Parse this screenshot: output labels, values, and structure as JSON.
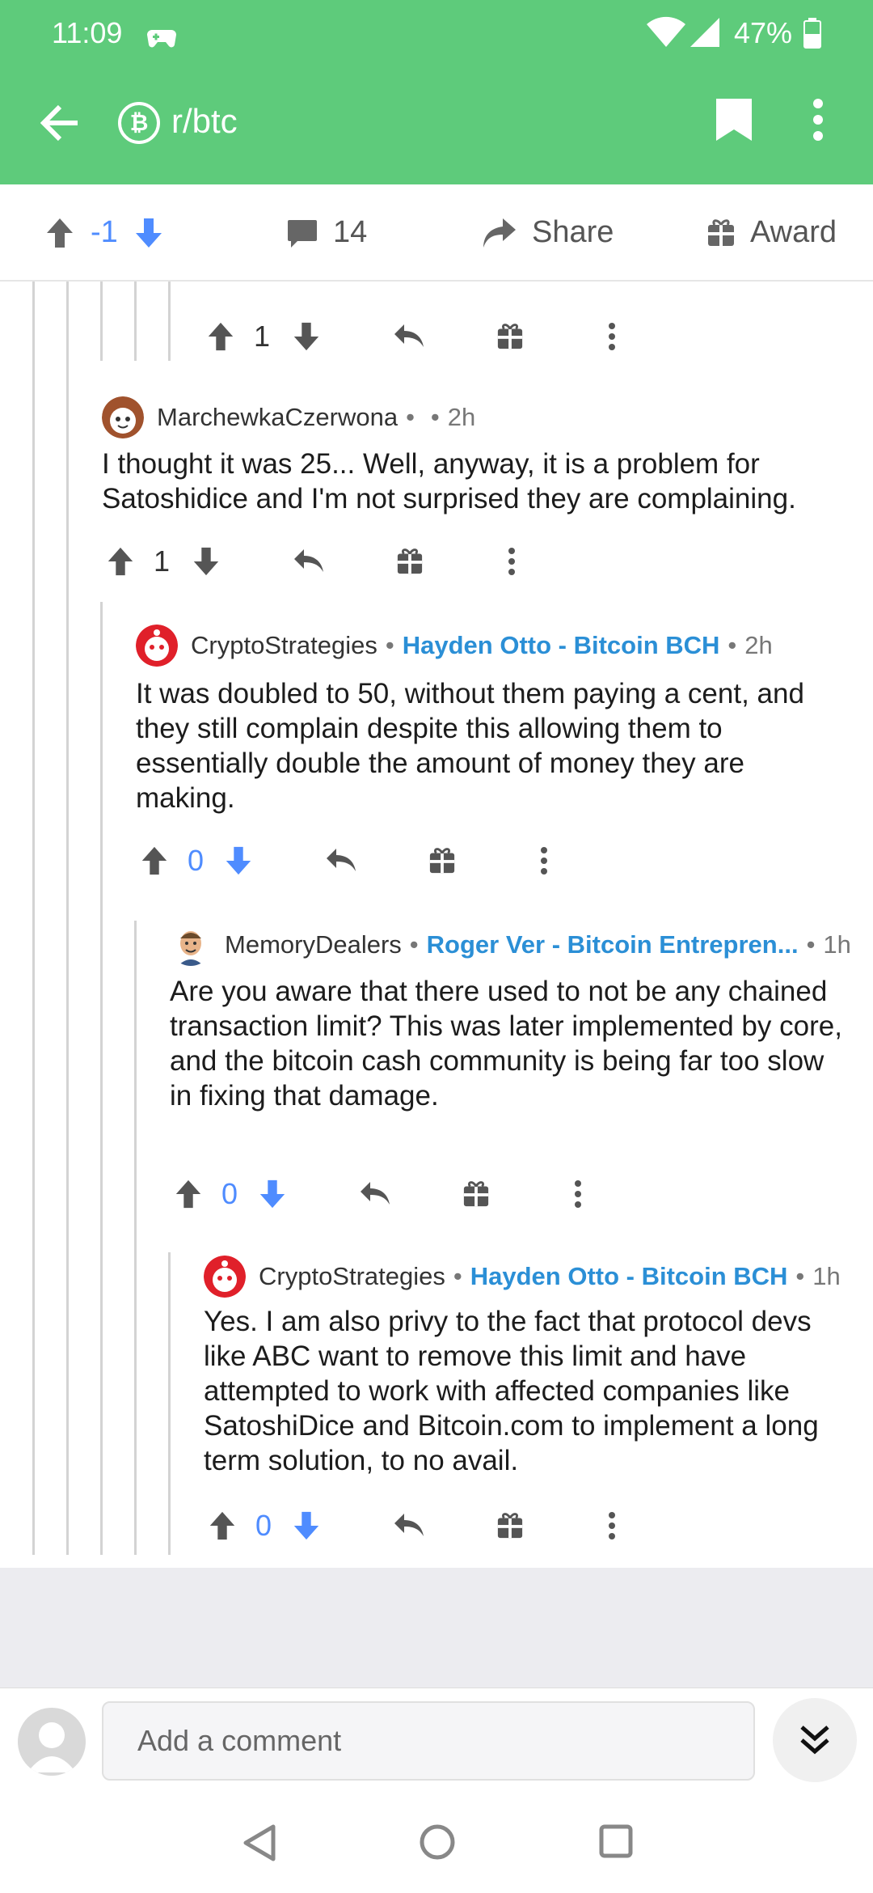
{
  "status_bar": {
    "time": "11:09",
    "battery": "47%",
    "icons": [
      "gamepad-icon",
      "wifi-icon",
      "signal-icon",
      "battery-icon"
    ]
  },
  "header": {
    "subreddit": "r/btc",
    "subreddit_icon": "bitcoin-icon",
    "color": "#5ecb7b"
  },
  "action_bar": {
    "score": "-1",
    "comments": "14",
    "share": "Share",
    "award": "Award"
  },
  "comments": [
    {
      "score": "1"
    },
    {
      "author": "MarchewkaCzerwona",
      "sep1": "•",
      "sep2": "•",
      "age": "2h",
      "body": "I thought it was 25... Well, anyway, it is a problem for Satoshidice and I'm not surprised they are complaining.",
      "score": "1"
    },
    {
      "author": "CryptoStrategies",
      "sep1": "•",
      "flair": "Hayden Otto - Bitcoin BCH",
      "sep2": "•",
      "age": "2h",
      "body": "It was doubled to 50, without them paying a cent, and they still complain despite this allowing them to essentially double the amount of money they are making.",
      "score": "0"
    },
    {
      "author": "MemoryDealers",
      "sep1": "•",
      "flair": "Roger Ver - Bitcoin Entrepren...",
      "sep2": "•",
      "age": "1h",
      "body": "Are you aware that there used to not be any chained  transaction limit? This was later implemented by core, and the bitcoin cash community is being far too slow in fixing that damage.",
      "score": "0"
    },
    {
      "author": "CryptoStrategies",
      "sep1": "•",
      "flair": "Hayden Otto - Bitcoin BCH",
      "sep2": "•",
      "age": "1h",
      "body": "Yes. I am also privy to the fact that protocol devs like ABC want to remove this limit and have attempted to work with affected companies like SatoshiDice and Bitcoin.com to implement a long term solution, to no avail.",
      "score": "0"
    }
  ],
  "composer": {
    "placeholder": "Add a comment"
  },
  "colors": {
    "accent_green": "#5ecb7b",
    "downvote_blue": "#4f8cff",
    "flair_blue": "#2b8fd6"
  }
}
